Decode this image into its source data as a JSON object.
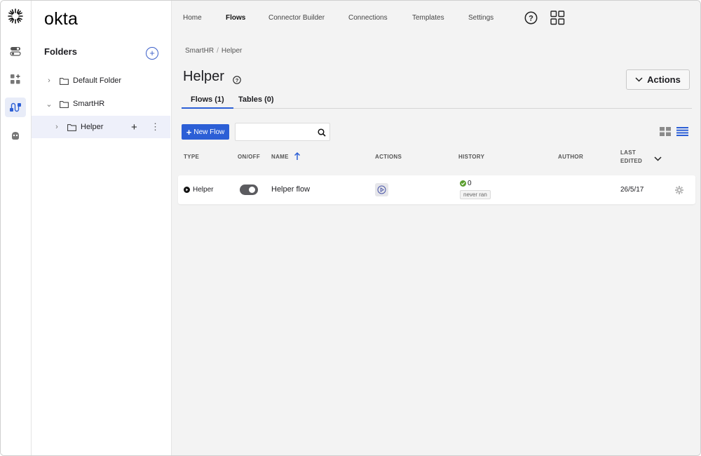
{
  "app": {
    "logo": "okta"
  },
  "rail": {
    "icons": [
      "okta-sun-icon",
      "toggles-icon",
      "apps-add-icon",
      "flows-icon",
      "connector-hand-icon"
    ]
  },
  "folders": {
    "title": "Folders",
    "items": [
      {
        "label": "Default Folder",
        "expanded": false
      },
      {
        "label": "SmartHR",
        "expanded": true
      },
      {
        "label": "Helper",
        "expanded": false,
        "selected": true
      }
    ]
  },
  "nav": {
    "items": [
      "Home",
      "Flows",
      "Connector Builder",
      "Connections",
      "Templates",
      "Settings"
    ],
    "active": "Flows"
  },
  "breadcrumb": {
    "items": [
      "SmartHR",
      "Helper"
    ]
  },
  "page": {
    "title": "Helper"
  },
  "actions": {
    "label": "Actions"
  },
  "tabs": [
    {
      "label": "Flows (1)",
      "active": true
    },
    {
      "label": "Tables (0)",
      "active": false
    }
  ],
  "toolbar": {
    "new_flow_label": "New Flow",
    "search_value": ""
  },
  "table": {
    "headers": {
      "type": "TYPE",
      "onoff": "ON/OFF",
      "name": "NAME",
      "actions": "ACTIONS",
      "history": "HISTORY",
      "author": "AUTHOR",
      "last_edited_1": "LAST",
      "last_edited_2": "EDITED"
    },
    "rows": [
      {
        "type": "Helper",
        "on": false,
        "name": "Helper flow",
        "history_count": "0",
        "history_status": "never ran",
        "author": "",
        "last_edited": "26/5/17"
      }
    ]
  },
  "colors": {
    "accent": "#2c5fd6",
    "success": "#5a9e2e",
    "selected_bg": "#eef0fa"
  }
}
